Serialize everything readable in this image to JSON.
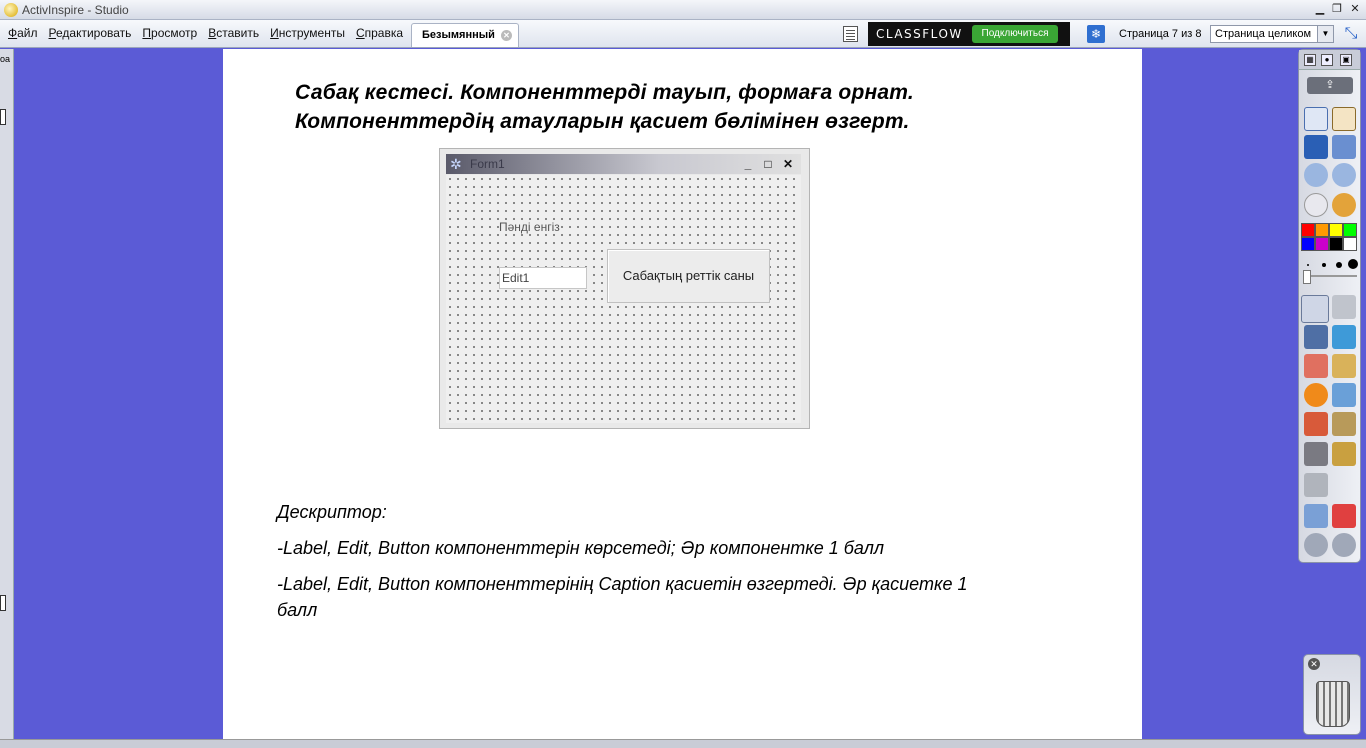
{
  "window": {
    "title": "ActivInspire - Studio"
  },
  "menu": [
    "Файл",
    "Редактировать",
    "Просмотр",
    "Вставить",
    "Инструменты",
    "Справка"
  ],
  "tab": {
    "label": "Безымянный"
  },
  "classflow": {
    "brand": "CLASSFLOW",
    "connect_label": "Подключиться"
  },
  "page_counter": "Страница 7 из 8",
  "zoom": {
    "selected": "Страница целиком"
  },
  "left_panel": {
    "label": "оа"
  },
  "page": {
    "heading_line1": "Сабақ кестесі. Компоненттерді тауып, формаға орнат.",
    "heading_line2": "Компоненттердің атауларын қасиет бөлімінен өзгерт.",
    "form": {
      "caption": "Form1",
      "label_text": "Пәнді енгіз",
      "edit_text": "Edit1",
      "button_text": "Сабақтың реттік саны"
    },
    "descriptor": {
      "title": "Дескриптор:",
      "line1": "-Label, Edit, Button компоненттерін көрсетеді; Әр компонентке 1 балл",
      "line2": "-Label, Edit, Button компоненттерінің Caption қасиетін өзгертеді. Әр қасиетке 1 балл"
    }
  },
  "palette_colors": [
    "#ff0000",
    "#ff9900",
    "#ffff00",
    "#00ff00",
    "#0000ff",
    "#cc00cc",
    "#000000",
    "#ffffff"
  ],
  "accent_colors": {
    "desktop": "#5b5bd6",
    "classflow_connect": "#3aa635"
  }
}
